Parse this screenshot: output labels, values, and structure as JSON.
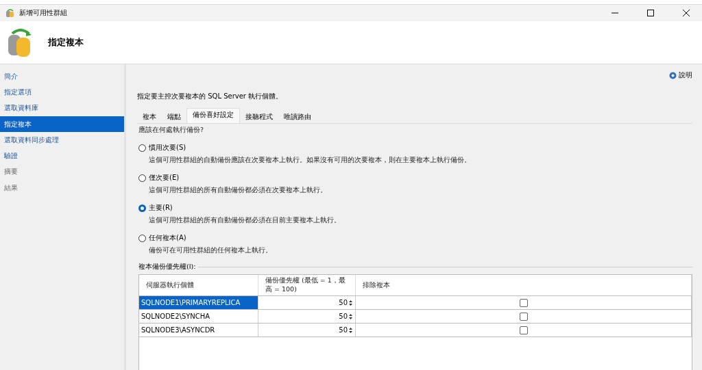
{
  "window": {
    "title": "新增可用性群組"
  },
  "header": {
    "title": "指定複本"
  },
  "sidebar": {
    "items": [
      {
        "label": "簡介",
        "selected": false,
        "disabled": false
      },
      {
        "label": "指定選項",
        "selected": false,
        "disabled": false
      },
      {
        "label": "選取資料庫",
        "selected": false,
        "disabled": false
      },
      {
        "label": "指定複本",
        "selected": true,
        "disabled": false
      },
      {
        "label": "選取資料同步處理",
        "selected": false,
        "disabled": false
      },
      {
        "label": "驗證",
        "selected": false,
        "disabled": false
      },
      {
        "label": "摘要",
        "selected": false,
        "disabled": true
      },
      {
        "label": "結果",
        "selected": false,
        "disabled": true
      }
    ]
  },
  "help": {
    "label": "說明"
  },
  "instruction": "指定要主控次要複本的 SQL Server 執行個體。",
  "tabs": [
    {
      "label": "複本",
      "selected": false
    },
    {
      "label": "端點",
      "selected": false
    },
    {
      "label": "備份喜好設定",
      "selected": true
    },
    {
      "label": "接聽程式",
      "selected": false
    },
    {
      "label": "唯讀路由",
      "selected": false
    }
  ],
  "backup_preference": {
    "question": "應該在何處執行備份?",
    "options": [
      {
        "label": "慣用次要(S)",
        "description": "這個可用性群組的自動備份應該在次要複本上執行。如果沒有可用的次要複本，則在主要複本上執行備份。",
        "selected": false
      },
      {
        "label": "僅次要(E)",
        "description": "這個可用性群組的所有自動備份都必須在次要複本上執行。",
        "selected": false
      },
      {
        "label": "主要(R)",
        "description": "這個可用性群組的所有自動備份都必須在目前主要複本上執行。",
        "selected": true
      },
      {
        "label": "任何複本(A)",
        "description": "備份可在可用性群組的任何複本上執行。",
        "selected": false
      }
    ]
  },
  "priority_table": {
    "title": "複本備份優先權(I):",
    "columns": [
      "伺服器執行個體",
      "備份優先權 (最低 = 1，最高 = 100)",
      "排除複本"
    ],
    "rows": [
      {
        "server": "SQLNODE1\\PRIMARYREPLICA",
        "priority": "50",
        "excluded": false,
        "selected": true
      },
      {
        "server": "SQLNODE2\\SYNCHA",
        "priority": "50",
        "excluded": false,
        "selected": false
      },
      {
        "server": "SQLNODE3\\ASYNCDR",
        "priority": "50",
        "excluded": false,
        "selected": false
      }
    ]
  }
}
